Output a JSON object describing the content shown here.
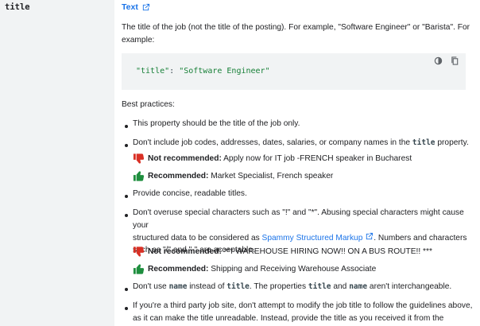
{
  "property": {
    "name": "title"
  },
  "type": {
    "label": "Text",
    "icon": "external-link-icon"
  },
  "description": "The title of the job (not the title of the posting). For example, \"Software Engineer\" or \"Barista\". For example:",
  "code": {
    "key": "\"title\"",
    "punct": ": ",
    "value": "\"Software Engineer\"",
    "icons": [
      "theme-toggle-icon",
      "copy-icon"
    ]
  },
  "best_practices": {
    "heading": "Best practices:",
    "items": [
      {
        "text": "This property should be the title of the job only."
      },
      {
        "pre": "Don't include job codes, addresses, dates, salaries, or company names in the ",
        "code": "title",
        "post": " property."
      },
      {
        "text": "Provide concise, readable titles."
      },
      {
        "line1": "Don't overuse special characters such as \"!\" and \"*\". Abusing special characters might cause your",
        "line2_pre": "structured data to be considered as ",
        "link": "Spammy Structured Markup",
        "line2_post": ". Numbers and characters",
        "line3": "such as \"/\" and \"-\" are acceptable."
      },
      {
        "pre": "Don't use ",
        "code1": "name",
        "mid1": " instead of ",
        "code2": "title",
        "mid2": ". The properties ",
        "code3": "title",
        "mid3": " and ",
        "code4": "name",
        "post": " aren't interchangeable."
      },
      {
        "line1": "If you're a third party job site, don't attempt to modify the job title to follow the guidelines above,",
        "line2": "as it can make the title unreadable. Instead, provide the title as you received it from the employer."
      }
    ],
    "examples": [
      {
        "label": "Not recommended:",
        "text": " Apply now for IT job -FRENCH speaker in Bucharest",
        "icon": "thumbs-down-icon",
        "color": "#d93025"
      },
      {
        "label": "Recommended:",
        "text": " Market Specialist, French speaker",
        "icon": "thumbs-up-icon",
        "color": "#1e8e3e"
      },
      {
        "label": "Not recommended:",
        "text": " *** WAREHOUSE HIRING NOW!! ON A BUS ROUTE!! ***",
        "icon": "thumbs-down-icon",
        "color": "#d93025"
      },
      {
        "label": "Recommended:",
        "text": " Shipping and Receiving Warehouse Associate",
        "icon": "thumbs-up-icon",
        "color": "#1e8e3e"
      }
    ]
  }
}
